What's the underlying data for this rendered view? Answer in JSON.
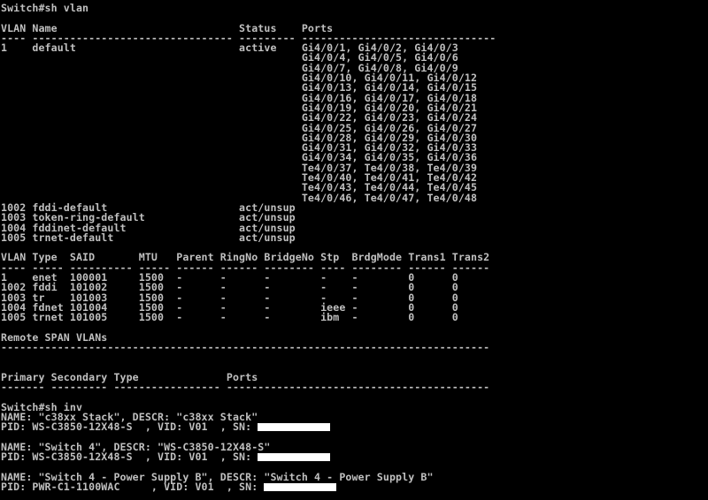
{
  "terminal": {
    "fg": "#c0c0c0",
    "bg": "#000000",
    "redaction_color": "#ffffff",
    "lines": [
      "Switch#sh vlan",
      "",
      "VLAN Name                             Status    Ports",
      "---- -------------------------------- --------- -------------------------------",
      "1    default                          active    Gi4/0/1, Gi4/0/2, Gi4/0/3",
      "                                                Gi4/0/4, Gi4/0/5, Gi4/0/6",
      "                                                Gi4/0/7, Gi4/0/8, Gi4/0/9",
      "                                                Gi4/0/10, Gi4/0/11, Gi4/0/12",
      "                                                Gi4/0/13, Gi4/0/14, Gi4/0/15",
      "                                                Gi4/0/16, Gi4/0/17, Gi4/0/18",
      "                                                Gi4/0/19, Gi4/0/20, Gi4/0/21",
      "                                                Gi4/0/22, Gi4/0/23, Gi4/0/24",
      "                                                Gi4/0/25, Gi4/0/26, Gi4/0/27",
      "                                                Gi4/0/28, Gi4/0/29, Gi4/0/30",
      "                                                Gi4/0/31, Gi4/0/32, Gi4/0/33",
      "                                                Gi4/0/34, Gi4/0/35, Gi4/0/36",
      "                                                Te4/0/37, Te4/0/38, Te4/0/39",
      "                                                Te4/0/40, Te4/0/41, Te4/0/42",
      "                                                Te4/0/43, Te4/0/44, Te4/0/45",
      "                                                Te4/0/46, Te4/0/47, Te4/0/48",
      "1002 fddi-default                     act/unsup",
      "1003 token-ring-default               act/unsup",
      "1004 fddinet-default                  act/unsup",
      "1005 trnet-default                    act/unsup",
      "",
      "VLAN Type  SAID       MTU   Parent RingNo BridgeNo Stp  BrdgMode Trans1 Trans2",
      "---- ----- ---------- ----- ------ ------ -------- ---- -------- ------ ------",
      "1    enet  100001     1500  -      -      -        -    -        0      0",
      "1002 fddi  101002     1500  -      -      -        -    -        0      0",
      "1003 tr    101003     1500  -      -      -        -    -        0      0",
      "1004 fdnet 101004     1500  -      -      -        ieee -        0      0",
      "1005 trnet 101005     1500  -      -      -        ibm  -        0      0",
      "",
      "Remote SPAN VLANs",
      "------------------------------------------------------------------------------",
      "",
      "",
      "Primary Secondary Type              Ports",
      "------- --------- ----------------- ------------------------------------------",
      "",
      "Switch#sh inv",
      "NAME: \"c38xx Stack\", DESCR: \"c38xx Stack\"",
      "PID: WS-C3850-12X48-S  , VID: V01  , SN: ",
      "",
      "NAME: \"Switch 4\", DESCR: \"WS-C3850-12X48-S\"",
      "PID: WS-C3850-12X48-S  , VID: V01  , SN: ",
      "",
      "NAME: \"Switch 4 - Power Supply B\", DESCR: \"Switch 4 - Power Supply B\"",
      "PID: PWR-C1-1100WAC     , VID: V01  , SN: "
    ],
    "redacted_line_indices": [
      42,
      45,
      48
    ]
  }
}
